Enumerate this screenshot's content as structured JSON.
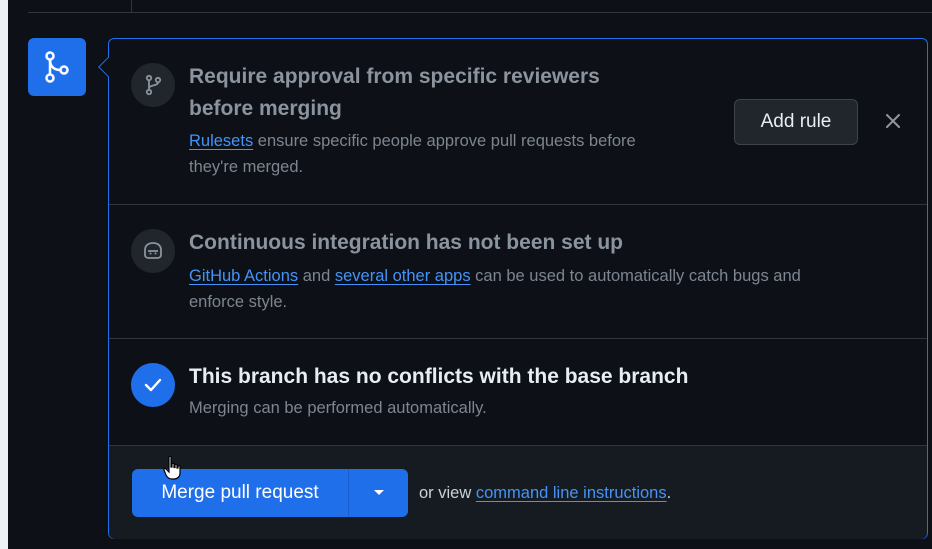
{
  "rule_section": {
    "title_line1": "Require approval from specific reviewers",
    "title_line2": "before merging",
    "desc_link": "Rulesets",
    "desc_text1": " ensure specific people approve pull requests before",
    "desc_text2": "they're merged.",
    "add_rule_label": "Add rule",
    "close_icon": "×"
  },
  "ci_section": {
    "title": "Continuous integration has not been set up",
    "link1": "GitHub Actions",
    "text_and": " and ",
    "link2": "several other apps",
    "text_rest": " can be used to automatically catch bugs and",
    "text_line2": "enforce style."
  },
  "conflict_section": {
    "title": "This branch has no conflicts with the base branch",
    "desc": "Merging can be performed automatically."
  },
  "merge_section": {
    "merge_button_label": "Merge pull request",
    "or_view_text": "or view ",
    "cmd_link": "command line instructions",
    "period": "."
  },
  "colors": {
    "accent": "#1f6feb",
    "link": "#4493f8",
    "background": "#0d1117"
  }
}
